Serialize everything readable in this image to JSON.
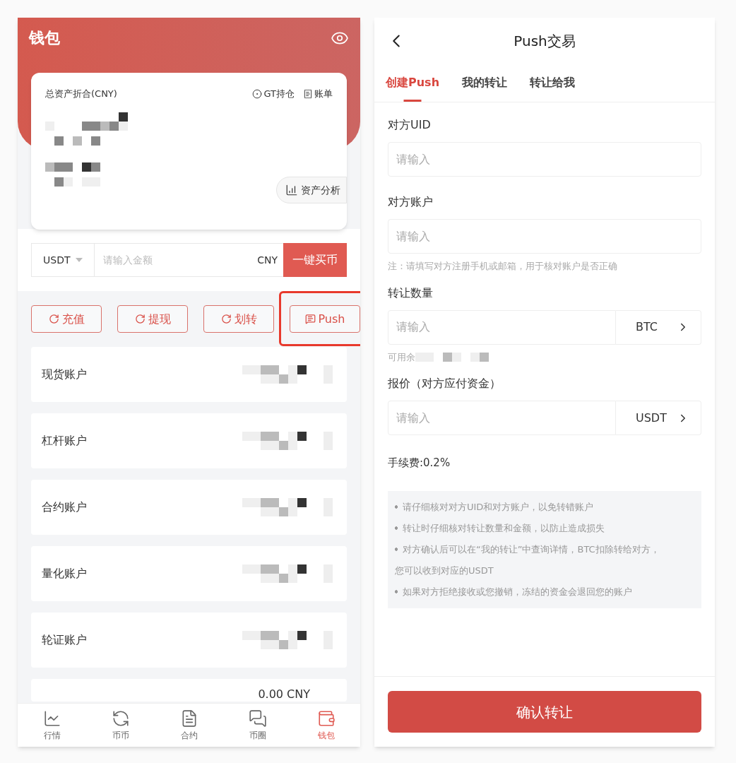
{
  "wallet": {
    "title": "钱包",
    "card": {
      "label": "总资产折合(CNY)",
      "links": [
        {
          "kind": "position",
          "label": "GT持仓"
        },
        {
          "kind": "bill",
          "label": "账单"
        }
      ],
      "analysis": "资产分析"
    },
    "buy": {
      "currency": "USDT",
      "placeholder": "请输入金额",
      "unit": "CNY",
      "button": "一键买币"
    },
    "actions": [
      {
        "kind": "refresh",
        "label": "充值",
        "highlighted": false
      },
      {
        "kind": "refresh",
        "label": "提现",
        "highlighted": false
      },
      {
        "kind": "refresh",
        "label": "划转",
        "highlighted": false
      },
      {
        "kind": "chat",
        "label": "Push",
        "highlighted": true
      }
    ],
    "accounts": [
      "现货账户",
      "杠杆账户",
      "合约账户",
      "量化账户",
      "轮证账户"
    ],
    "partial_row": "0.00 CNY",
    "nav": [
      {
        "kind": "chart",
        "label": "行情",
        "selected": false
      },
      {
        "kind": "exchange",
        "label": "币币",
        "selected": false
      },
      {
        "kind": "document",
        "label": "合约",
        "selected": false
      },
      {
        "kind": "chat",
        "label": "币圈",
        "selected": false
      },
      {
        "kind": "wallet",
        "label": "钱包",
        "selected": true
      }
    ]
  },
  "push": {
    "title": "Push交易",
    "tabs": [
      {
        "label": "创建Push",
        "selected": true
      },
      {
        "label": "我的转让",
        "selected": false
      },
      {
        "label": "转让给我",
        "selected": false
      }
    ],
    "fields": [
      {
        "kind": "text",
        "label": "对方UID",
        "placeholder": "请输入"
      },
      {
        "kind": "text",
        "label": "对方账户",
        "placeholder": "请输入",
        "note": "注：请填写对方注册手机或邮箱，用于核对账户是否正确"
      },
      {
        "kind": "unit",
        "label": "转让数量",
        "placeholder": "请输入",
        "unit": "BTC",
        "note": "可用余"
      },
      {
        "kind": "unit",
        "label": "报价（对方应付资金）",
        "placeholder": "请输入",
        "unit": "USDT"
      }
    ],
    "fee": "手续费:0.2%",
    "tips": [
      {
        "bullet": true,
        "text": "请仔细核对对方UID和对方账户，以免转错账户"
      },
      {
        "bullet": true,
        "text": "转让时仔细核对转让数量和金额，以防止造成损失"
      },
      {
        "bullet": true,
        "text": "对方确认后可以在“我的转让”中查询详情，BTC扣除转给对方，"
      },
      {
        "bullet": false,
        "text": "您可以收到对应的USDT"
      },
      {
        "bullet": true,
        "text": "如果对方拒绝接收或您撤销，冻结的资金会退回您的账户"
      }
    ],
    "confirm": "确认转让"
  }
}
